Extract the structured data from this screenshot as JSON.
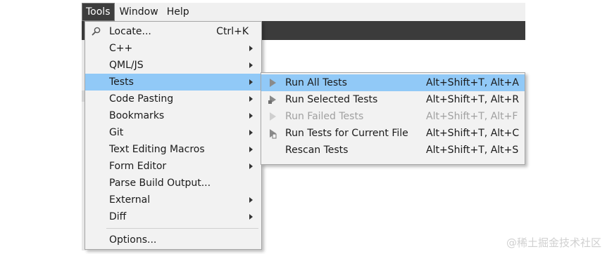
{
  "menubar": {
    "items": [
      {
        "label": "Tools",
        "active": true
      },
      {
        "label": "Window",
        "active": false
      },
      {
        "label": "Help",
        "active": false
      }
    ]
  },
  "tools_menu": {
    "items": [
      {
        "label": "Locate...",
        "shortcut": "Ctrl+K",
        "icon": "magnifier-icon"
      },
      {
        "label": "C++",
        "submenu": true
      },
      {
        "label": "QML/JS",
        "submenu": true
      },
      {
        "label": "Tests",
        "submenu": true,
        "highlighted": true
      },
      {
        "label": "Code Pasting",
        "submenu": true
      },
      {
        "label": "Bookmarks",
        "submenu": true
      },
      {
        "label": "Git",
        "submenu": true
      },
      {
        "label": "Text Editing Macros",
        "submenu": true
      },
      {
        "label": "Form Editor",
        "submenu": true
      },
      {
        "label": "Parse Build Output..."
      },
      {
        "label": "External",
        "submenu": true
      },
      {
        "label": "Diff",
        "submenu": true
      },
      {
        "label": "Options..."
      }
    ]
  },
  "tests_menu": {
    "items": [
      {
        "label": "Run All Tests",
        "shortcut": "Alt+Shift+T, Alt+A",
        "icon": "run-icon",
        "highlighted": true
      },
      {
        "label": "Run Selected Tests",
        "shortcut": "Alt+Shift+T, Alt+R",
        "icon": "run-selected-icon"
      },
      {
        "label": "Run Failed Tests",
        "shortcut": "Alt+Shift+T, Alt+F",
        "icon": "run-failed-icon",
        "disabled": true
      },
      {
        "label": "Run Tests for Current File",
        "shortcut": "Alt+Shift+T, Alt+C",
        "icon": "run-file-icon"
      },
      {
        "label": "Rescan Tests",
        "shortcut": "Alt+Shift+T, Alt+S"
      }
    ]
  },
  "watermark": "@稀土掘金技术社区",
  "colors": {
    "highlight": "#91c9f7",
    "menu_bg": "#f2f2f2",
    "active_menubar_bg": "#3d3d3d",
    "disabled_text": "#a0a0a0"
  }
}
